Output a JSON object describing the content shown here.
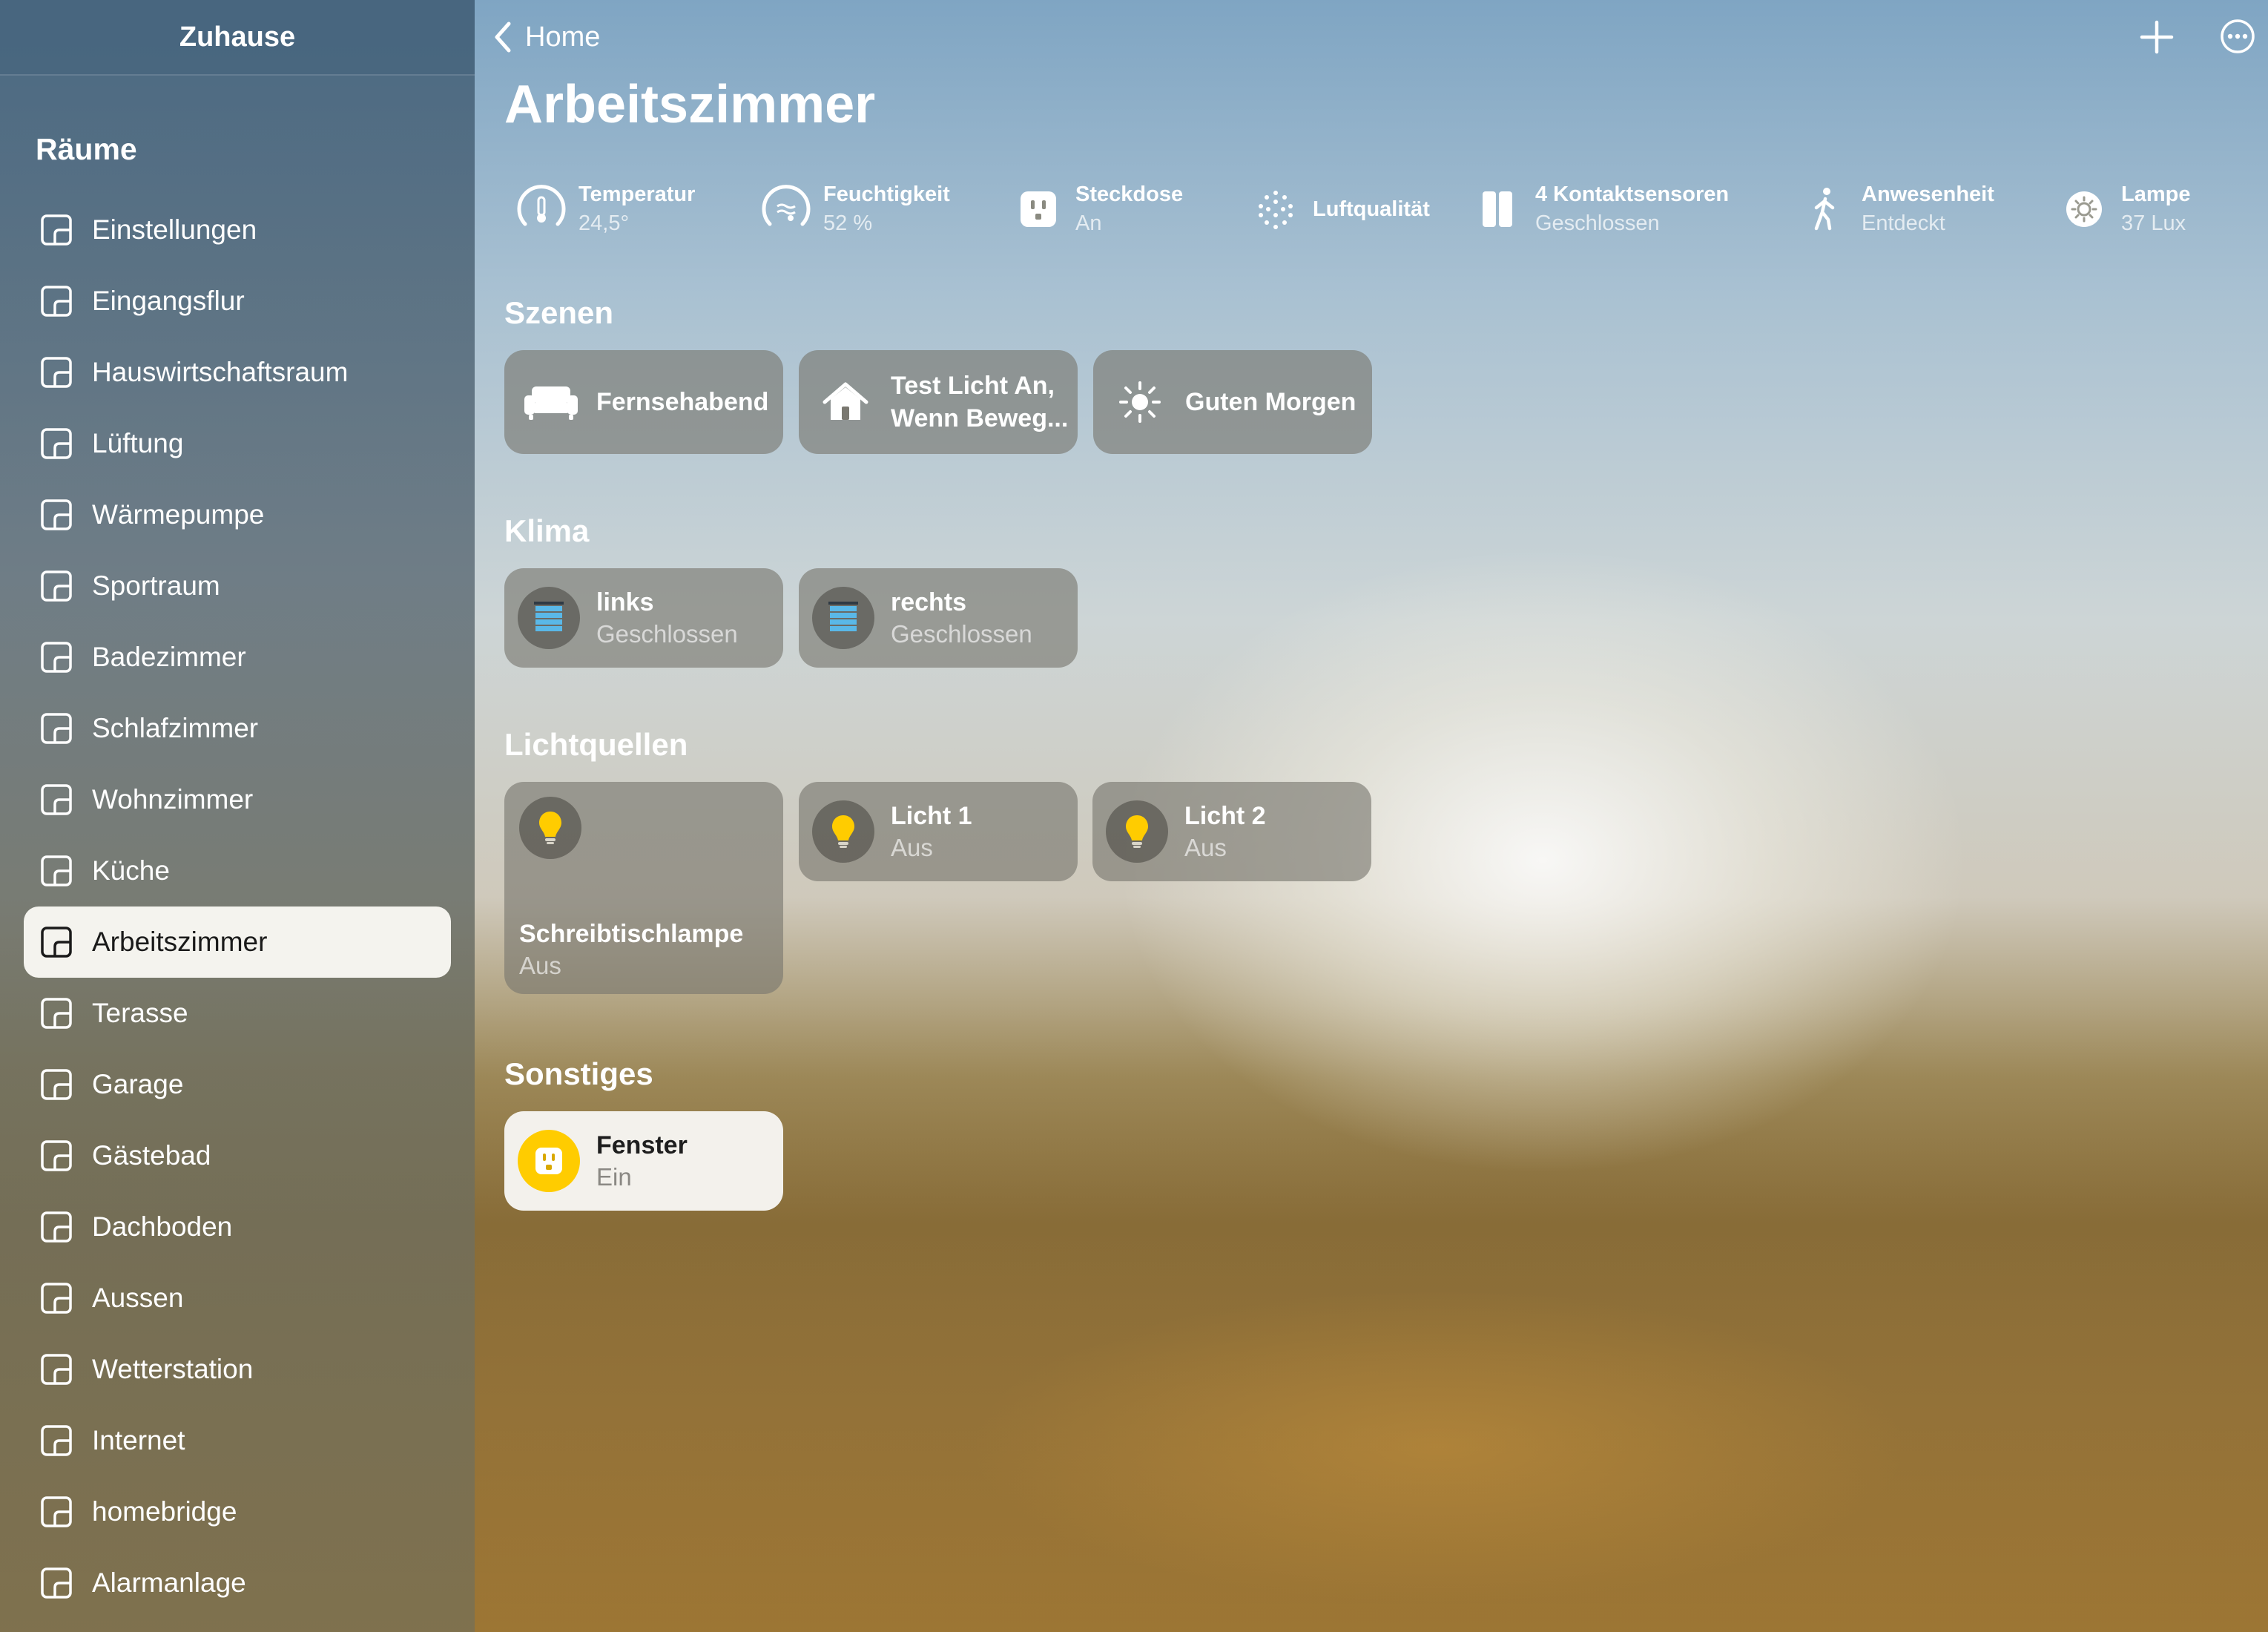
{
  "sidebar": {
    "header": "Zuhause",
    "section_title": "Räume",
    "rooms": [
      {
        "label": "Einstellungen"
      },
      {
        "label": "Eingangsflur"
      },
      {
        "label": "Hauswirtschaftsraum"
      },
      {
        "label": "Lüftung"
      },
      {
        "label": "Wärmepumpe"
      },
      {
        "label": "Sportraum"
      },
      {
        "label": "Badezimmer"
      },
      {
        "label": "Schlafzimmer"
      },
      {
        "label": "Wohnzimmer"
      },
      {
        "label": "Küche"
      },
      {
        "label": "Arbeitszimmer"
      },
      {
        "label": "Terasse"
      },
      {
        "label": "Garage"
      },
      {
        "label": "Gästebad"
      },
      {
        "label": "Dachboden"
      },
      {
        "label": "Aussen"
      },
      {
        "label": "Wetterstation"
      },
      {
        "label": "Internet"
      },
      {
        "label": "homebridge"
      },
      {
        "label": "Alarmanlage"
      }
    ],
    "selected_room": "Arbeitszimmer"
  },
  "topbar": {
    "back_label": "Home",
    "add_icon": "plus-icon",
    "more_icon": "ellipsis-circle-icon"
  },
  "page_title": "Arbeitszimmer",
  "status": [
    {
      "title": "Temperatur",
      "value": "24,5°",
      "icon": "thermometer-gauge-icon"
    },
    {
      "title": "Feuchtigkeit",
      "value": "52 %",
      "icon": "humidity-gauge-icon"
    },
    {
      "title": "Steckdose",
      "value": "An",
      "icon": "outlet-icon"
    },
    {
      "title": "Luftqualität",
      "value": "",
      "icon": "air-quality-icon"
    },
    {
      "title": "4 Kontaktsensoren",
      "value": "Geschlossen",
      "icon": "contact-sensor-icon"
    },
    {
      "title": "Anwesenheit",
      "value": "Entdeckt",
      "icon": "motion-person-icon"
    },
    {
      "title": "Lampe",
      "value": "37 Lux",
      "icon": "light-sensor-icon"
    }
  ],
  "sections": {
    "scenes": "Szenen",
    "climate": "Klima",
    "lights": "Lichtquellen",
    "other": "Sonstiges"
  },
  "scenes": [
    {
      "label": "Fernsehabend",
      "icon": "sofa-icon"
    },
    {
      "line1": "Test Licht An,",
      "line2": "Wenn Beweg...",
      "icon": "house-icon"
    },
    {
      "label": "Guten Morgen",
      "icon": "sun-icon"
    }
  ],
  "climate": [
    {
      "name": "links",
      "state": "Geschlossen",
      "icon": "blinds-icon"
    },
    {
      "name": "rechts",
      "state": "Geschlossen",
      "icon": "blinds-icon"
    }
  ],
  "lights": [
    {
      "name": "Schreibtischlampe",
      "state": "Aus",
      "icon": "lightbulb-icon"
    },
    {
      "name": "Licht 1",
      "state": "Aus",
      "icon": "lightbulb-icon"
    },
    {
      "name": "Licht 2",
      "state": "Aus",
      "icon": "lightbulb-icon"
    }
  ],
  "other": [
    {
      "name": "Fenster",
      "state": "Ein",
      "icon": "outlet-icon"
    }
  ],
  "colors": {
    "accent_yellow": "#ffcc00",
    "blinds_blue": "#5ab8e8",
    "tile_active": "#f3f1ec"
  }
}
